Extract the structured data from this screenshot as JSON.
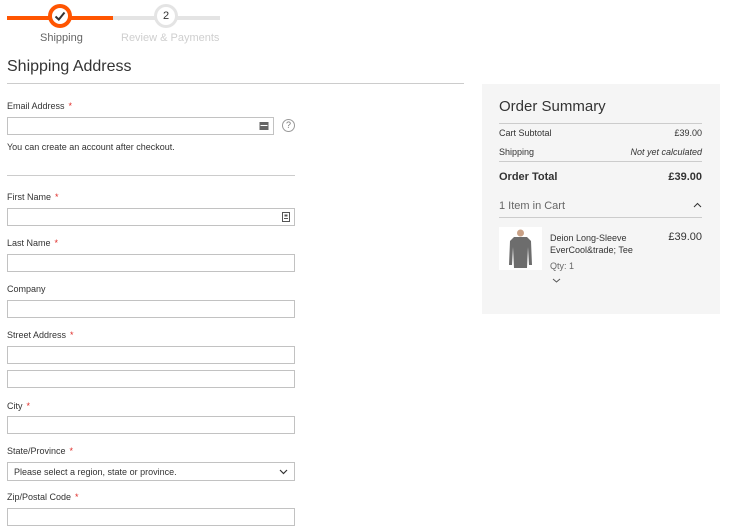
{
  "progress": {
    "step1_label": "Shipping",
    "step2_number": "2",
    "step2_label": "Review & Payments",
    "accent_color": "#ff5501"
  },
  "shipping": {
    "title": "Shipping Address",
    "email_label": "Email Address",
    "email_value": "",
    "email_note": "You can create an account after checkout.",
    "first_name_label": "First Name",
    "last_name_label": "Last Name",
    "company_label": "Company",
    "street_label": "Street Address",
    "city_label": "City",
    "state_label": "State/Province",
    "state_selected": "Please select a region, state or province.",
    "zip_label": "Zip/Postal Code",
    "required_mark": "*"
  },
  "summary": {
    "title": "Order Summary",
    "subtotal_label": "Cart Subtotal",
    "subtotal_value": "£39.00",
    "shipping_label": "Shipping",
    "shipping_value": "Not yet calculated",
    "total_label": "Order Total",
    "total_value": "£39.00",
    "items_toggle": "1 Item in Cart",
    "item": {
      "name": "Deion Long-Sleeve EverCool&trade; Tee",
      "price": "£39.00",
      "qty": "Qty: 1"
    }
  }
}
